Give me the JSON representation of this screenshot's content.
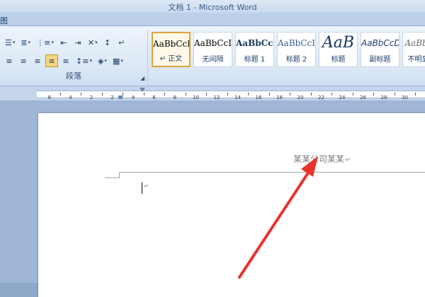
{
  "window": {
    "title": "文档 1 - Microsoft Word"
  },
  "tabstrip": {
    "visible_char": "图"
  },
  "paragraph_group": {
    "label": "段落",
    "row1": [
      {
        "name": "bullets-button",
        "icon": "☰",
        "caret": true
      },
      {
        "name": "numbering-button",
        "icon": "≣",
        "caret": true
      },
      {
        "name": "multilevel-list-button",
        "icon": "⋮≡",
        "caret": true
      },
      {
        "name": "decrease-indent-button",
        "icon": "⇤"
      },
      {
        "name": "increase-indent-button",
        "icon": "⇥"
      },
      {
        "name": "chinese-layout-button",
        "icon": "✕",
        "caret": true
      },
      {
        "name": "sort-button",
        "icon": "↕"
      },
      {
        "name": "show-marks-button",
        "icon": "↵"
      }
    ],
    "row2": [
      {
        "name": "align-left-button",
        "icon": "≡"
      },
      {
        "name": "align-center-button",
        "icon": "≡"
      },
      {
        "name": "align-right-button",
        "icon": "≡"
      },
      {
        "name": "justify-button",
        "icon": "≡",
        "selected": true
      },
      {
        "name": "distributed-button",
        "icon": "≡"
      },
      {
        "name": "line-spacing-button",
        "icon": "↕≡",
        "caret": true
      },
      {
        "name": "shading-button",
        "icon": "◈",
        "caret": true
      },
      {
        "name": "borders-button",
        "icon": "▦",
        "caret": true
      }
    ]
  },
  "styles": [
    {
      "preview": "AaBbCcI",
      "name": "↵ 正文",
      "selected": true,
      "kind": "normal"
    },
    {
      "preview": "AaBbCcI",
      "name": "无间隔",
      "kind": "normal"
    },
    {
      "preview": "AaBbCcl",
      "name": "标题 1",
      "kind": "h1"
    },
    {
      "preview": "AaBbCcI",
      "name": "标题 2",
      "kind": "h2"
    },
    {
      "preview": "AaB",
      "name": "标题",
      "kind": "t"
    },
    {
      "preview": "AaBbCcD",
      "name": "副标题",
      "kind": "sub"
    },
    {
      "preview": "AaBbCc",
      "name": "不明显强",
      "kind": "sem"
    }
  ],
  "ruler": {
    "numbers": [
      "6",
      "4",
      "2",
      "2",
      "4",
      "6",
      "8",
      "10",
      "12",
      "14",
      "16",
      "18",
      "20",
      "22",
      "24",
      "26",
      "28",
      "30"
    ]
  },
  "document": {
    "header_text": "某某公司某某",
    "paragraph_mark": "↵",
    "cursor_mark": "↵"
  },
  "annotation": {
    "arrow_color": "#e8332a"
  }
}
